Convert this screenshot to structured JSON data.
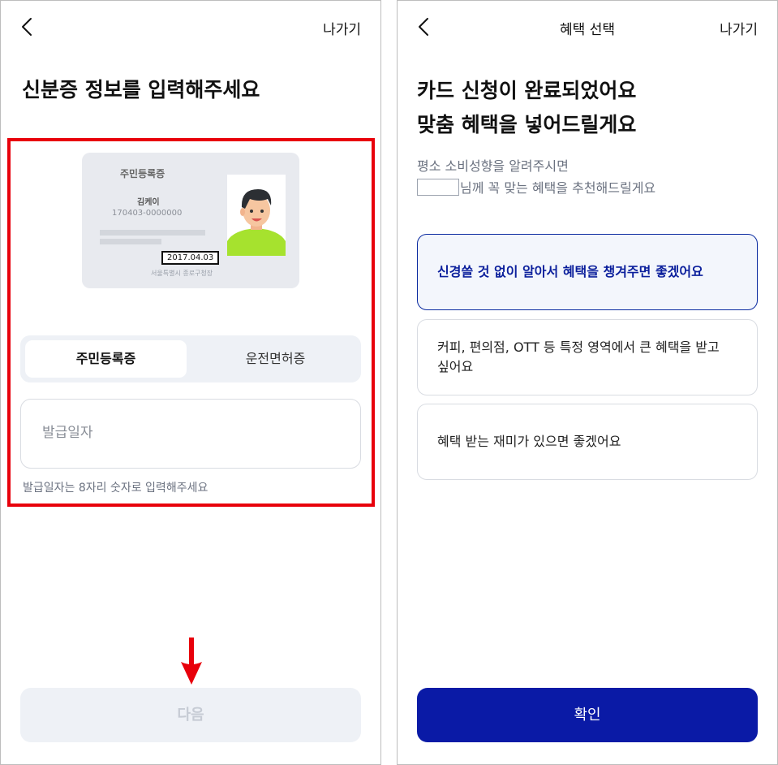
{
  "left_screen": {
    "header": {
      "exit_label": "나가기"
    },
    "title": "신분증 정보를 입력해주세요",
    "id_card": {
      "type_label": "주민등록증",
      "name": "김케이",
      "number": "170403-0000000",
      "issue_date": "2017.04.03",
      "issuer": "서울특별시 종로구청장"
    },
    "tabs": [
      {
        "label": "주민등록증",
        "selected": true
      },
      {
        "label": "운전면허증",
        "selected": false
      }
    ],
    "issue_date_field": {
      "placeholder": "발급일자",
      "value": ""
    },
    "hint": "발급일자는 8자리 숫자로 입력해주세요",
    "next_button": {
      "label": "다음",
      "enabled": false
    },
    "highlight_color": "#e8000b"
  },
  "right_screen": {
    "header": {
      "title": "혜택 선택",
      "exit_label": "나가기"
    },
    "title_line1": "카드 신청이 완료되었어요",
    "title_line2": "맞춤 혜택을 넣어드릴게요",
    "subtitle_line1": "평소 소비성향을 알려주시면",
    "subtitle_line2": "님께 꼭 맞는 혜택을 추천해드릴게요",
    "options": [
      {
        "label": "신경쓸 것 없이 알아서 혜택을 챙겨주면 좋겠어요",
        "selected": true
      },
      {
        "label": "커피, 편의점, OTT 등 특정 영역에서 큰 혜택을 받고 싶어요",
        "selected": false
      },
      {
        "label": "혜택 받는 재미가 있으면 좋겠어요",
        "selected": false
      }
    ],
    "confirm_button": {
      "label": "확인"
    },
    "accent_color": "#0a1aa6"
  },
  "icons": {
    "back": "chevron-left-icon",
    "annotation_arrow": "red-down-arrow-icon"
  }
}
